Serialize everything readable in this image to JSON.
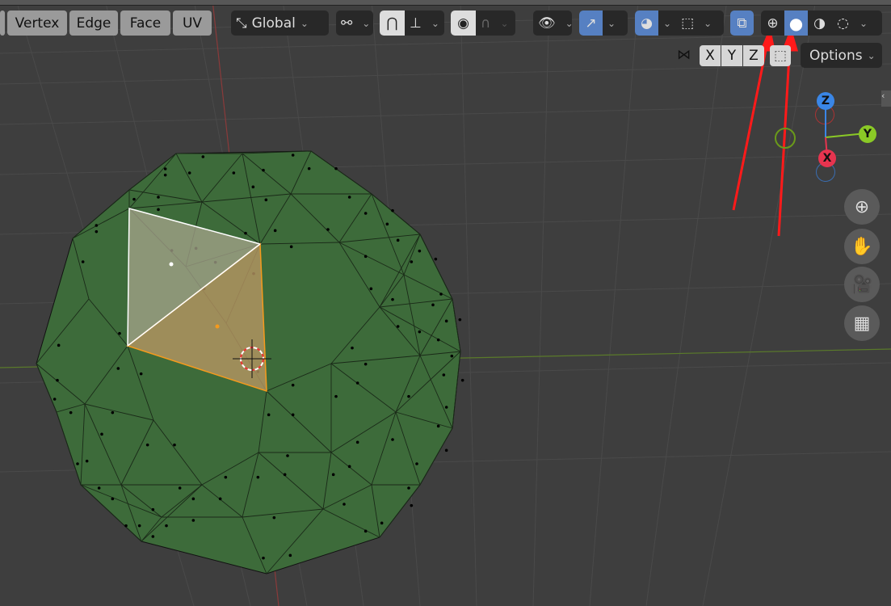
{
  "header": {
    "select_modes": [
      "Vertex",
      "Edge",
      "Face",
      "UV"
    ],
    "transform_orientation": "Global",
    "options_label": "Options",
    "mirror_axes": [
      "X",
      "Y",
      "Z"
    ],
    "shading_modes": [
      {
        "name": "wireframe",
        "active": false
      },
      {
        "name": "solid",
        "active": true
      },
      {
        "name": "material-preview",
        "active": false
      },
      {
        "name": "rendered",
        "active": false
      }
    ]
  },
  "gizmo": {
    "z": "Z",
    "y": "Y",
    "x": "X"
  },
  "colors": {
    "accent": "#5680c2",
    "mesh": "#3d6b3a",
    "selected_edge": "#ffffff",
    "active_face": "#f59a1c",
    "annotation": "#ff1a1a"
  }
}
